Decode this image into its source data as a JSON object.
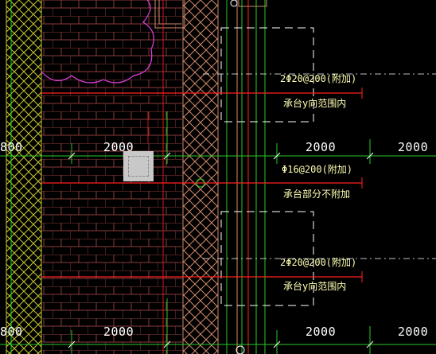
{
  "drawing": {
    "dimensions": {
      "left_top": "800",
      "mid_top": "2000",
      "right_a_top": "2000",
      "right_b_top": "2000",
      "left_bottom": "800",
      "mid_bottom": "2000",
      "right_a_bottom": "2000",
      "right_b_bottom": "2000"
    },
    "rebar_labels": {
      "upper": "2Φ20@200(附加)",
      "middle": "Φ16@200(附加)",
      "lower": "2Φ20@200(附加)"
    },
    "notes": {
      "upper": "承台y向范围内",
      "middle": "承台部分不附加",
      "lower": "承台y向范围内"
    },
    "colors": {
      "background": "#000000",
      "wall_hatch": "#c8c832",
      "brick_grid": "#8c3c3c",
      "rebar_red": "#ff2020",
      "green_line": "#28c828",
      "magenta_outline": "#e040e0",
      "text_yellow": "#ffffb4",
      "dim_white": "#ffffff"
    }
  }
}
